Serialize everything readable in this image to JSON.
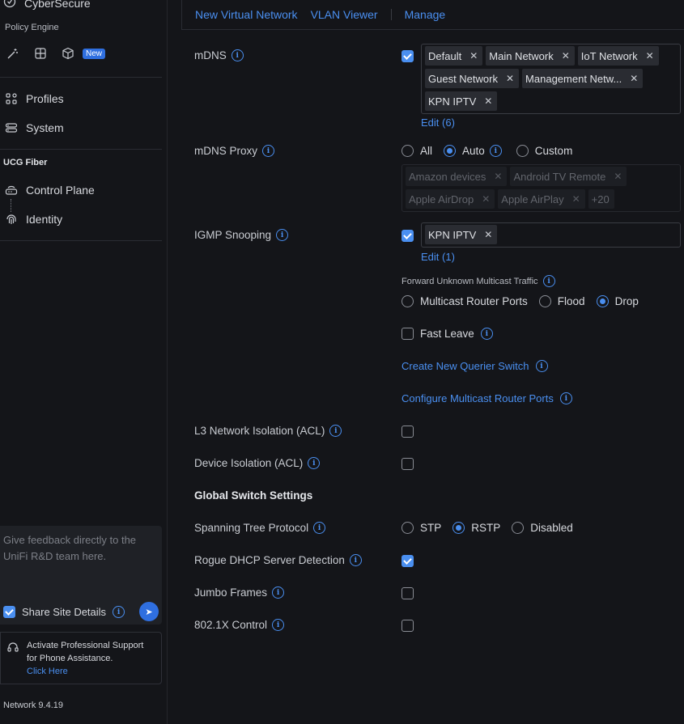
{
  "sidebar": {
    "app_name": "CyberSecure",
    "policy_engine_label": "Policy Engine",
    "new_badge": "New",
    "items": [
      {
        "label": "Profiles"
      },
      {
        "label": "System"
      }
    ],
    "gateway_group": "UCG Fiber",
    "gateway_items": [
      {
        "label": "Control Plane"
      },
      {
        "label": "Identity"
      }
    ],
    "feedback_placeholder": "Give feedback directly to the UniFi R&D team here.",
    "share_site_details": "Share Site Details",
    "support_text": "Activate Professional Support for Phone Assistance.",
    "support_link": "Click Here",
    "version": "Network 9.4.19"
  },
  "topbar": {
    "tabs": [
      "New Virtual Network",
      "VLAN Viewer",
      "Manage"
    ]
  },
  "settings": {
    "mdns": {
      "label": "mDNS",
      "checked": true,
      "tags": [
        "Default",
        "Main Network",
        "IoT Network",
        "Guest Network",
        "Management Netw...",
        "KPN IPTV"
      ],
      "edit_link": "Edit (6)"
    },
    "mdns_proxy": {
      "label": "mDNS Proxy",
      "options": [
        "All",
        "Auto",
        "Custom"
      ],
      "selected": "Auto",
      "tags": [
        "Amazon devices",
        "Android TV Remote",
        "Apple AirDrop",
        "Apple AirPlay"
      ],
      "more": "+20"
    },
    "igmp": {
      "label": "IGMP Snooping",
      "checked": true,
      "tags": [
        "KPN IPTV"
      ],
      "edit_link": "Edit (1)",
      "forward_label": "Forward Unknown Multicast Traffic",
      "forward_options": [
        "Multicast Router Ports",
        "Flood",
        "Drop"
      ],
      "forward_selected": "Drop",
      "fast_leave": "Fast Leave",
      "create_querier": "Create New Querier Switch",
      "configure_ports": "Configure Multicast Router Ports"
    },
    "l3_isolation": {
      "label": "L3 Network Isolation (ACL)",
      "checked": false
    },
    "device_isolation": {
      "label": "Device Isolation (ACL)",
      "checked": false
    },
    "global_switch_title": "Global Switch Settings",
    "stp": {
      "label": "Spanning Tree Protocol",
      "options": [
        "STP",
        "RSTP",
        "Disabled"
      ],
      "selected": "RSTP"
    },
    "rogue_dhcp": {
      "label": "Rogue DHCP Server Detection",
      "checked": true
    },
    "jumbo": {
      "label": "Jumbo Frames",
      "checked": false
    },
    "dot1x": {
      "label": "802.1X Control",
      "checked": false
    }
  },
  "colors": {
    "accent": "#4a8ff0",
    "background": "#141519",
    "panel": "#1f2126"
  }
}
